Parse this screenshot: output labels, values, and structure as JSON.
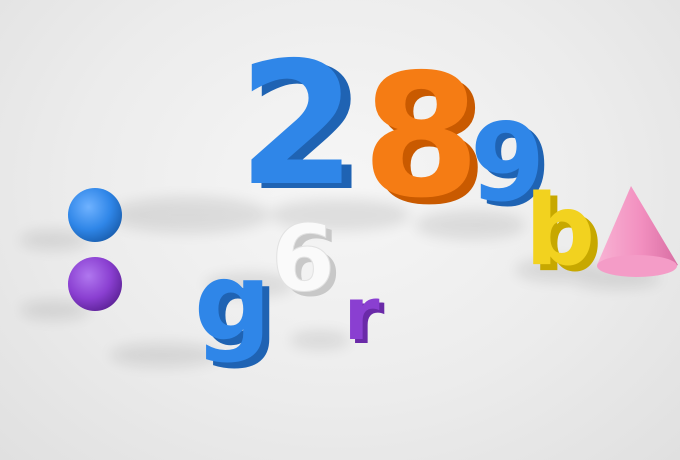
{
  "scene": {
    "characters": [
      {
        "id": "digit-2",
        "text": "2",
        "color": "#2f86e8",
        "shade": "#1f63b3"
      },
      {
        "id": "digit-8",
        "text": "8",
        "color": "#f57c14",
        "shade": "#c95a00"
      },
      {
        "id": "digit-9",
        "text": "9",
        "color": "#2f86e8",
        "shade": "#1f63b3"
      },
      {
        "id": "letter-b",
        "text": "b",
        "color": "#f2d21f",
        "shade": "#c7a800"
      },
      {
        "id": "digit-6",
        "text": "6",
        "color": "#fafafa",
        "shade": "#c8c8c8"
      },
      {
        "id": "letter-g",
        "text": "g",
        "color": "#2f86e8",
        "shade": "#1f63b3"
      },
      {
        "id": "letter-r",
        "text": "r",
        "color": "#8a3fd1",
        "shade": "#6a2aa8"
      }
    ],
    "shapes": [
      {
        "id": "blue-sphere",
        "type": "sphere",
        "color": "#2f86e8"
      },
      {
        "id": "purple-sphere",
        "type": "sphere",
        "color": "#8a3fd1"
      },
      {
        "id": "pink-cone",
        "type": "cone",
        "color": "#f28fbf"
      }
    ]
  }
}
